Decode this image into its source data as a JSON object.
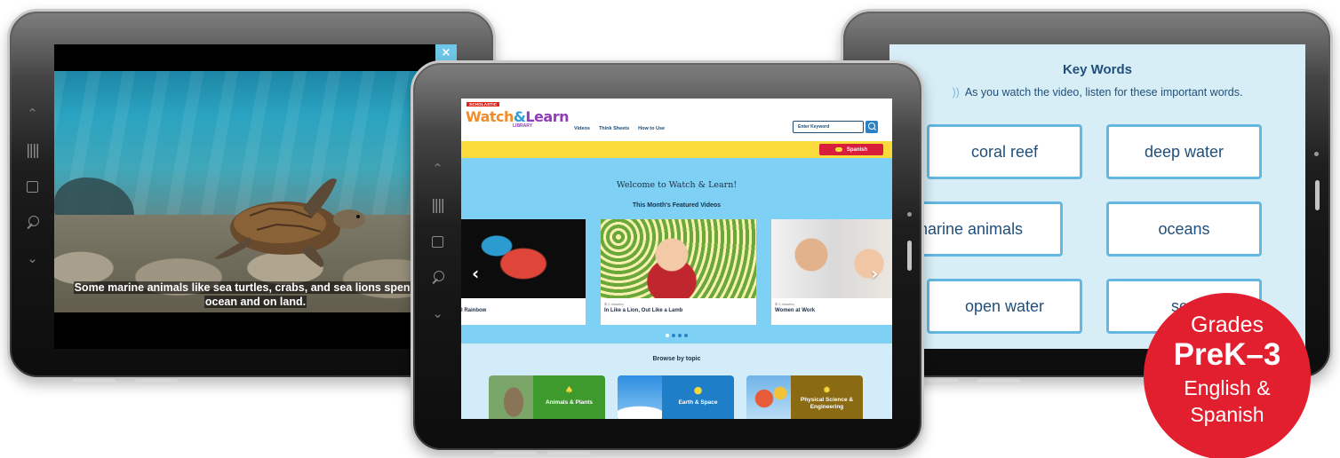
{
  "video_tablet": {
    "close_label": "×",
    "subtitle_line1": "Some marine animals like sea turtles, crabs, and sea lions spend tim",
    "subtitle_line2": "ocean and on land."
  },
  "tablet_nav_icons": [
    "chevron-up-icon",
    "recent-apps-icon",
    "home-icon",
    "search-icon",
    "chevron-down-icon"
  ],
  "website": {
    "brand_tag": "SCHOLASTIC",
    "logo_part1": "Watch",
    "logo_amp": "&",
    "logo_part2": "Learn",
    "logo_sub": "LIBRARY",
    "nav": [
      "Videos",
      "Think Sheets",
      "How to Use"
    ],
    "search_placeholder": "Enter Keyword",
    "spanish_label": "Spanish",
    "welcome": "Welcome to Watch & Learn!",
    "featured_heading": "This Month's Featured Videos",
    "cards": [
      {
        "meta": "",
        "title": "l Rainbow"
      },
      {
        "meta": "⏲ 2 minutes",
        "title": "In Like a Lion, Out Like a Lamb"
      },
      {
        "meta": "⏲ 2 minutes",
        "title": "Women at Work"
      }
    ],
    "prev_arrow": "‹",
    "next_arrow": "›",
    "browse_heading": "Browse by topic",
    "topics": [
      {
        "label": "Animals & Plants",
        "color": "#3f9a2e"
      },
      {
        "label": "Earth & Space",
        "color": "#1f7ec8"
      },
      {
        "label": "Physical Science & Engineering",
        "color": "#8a6a12"
      }
    ]
  },
  "key_words": {
    "title": "Key Words",
    "instruction": "As you watch the video, listen for these important words.",
    "words": [
      "coral reef",
      "deep water",
      "narine animals",
      "oceans",
      "open water",
      "sc"
    ]
  },
  "badge": {
    "line1": "Grades",
    "line2": "PreK–3",
    "line3": "English &",
    "line4": "Spanish",
    "color": "#e21f2e"
  }
}
